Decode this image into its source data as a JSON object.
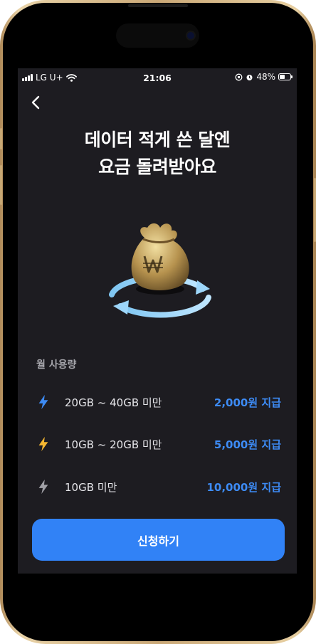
{
  "status_bar": {
    "carrier": "LG U+",
    "time": "21:06",
    "battery": "48%",
    "battery_level": 0.48
  },
  "header": {
    "back_icon": "chevron-left-icon"
  },
  "hero": {
    "title_line1": "데이터 적게 쓴 달엔",
    "title_line2": "요금 돌려받아요",
    "illustration_icon": "money-bag-icon"
  },
  "usage": {
    "section_label": "월 사용량",
    "tiers": [
      {
        "range": "20GB ~ 40GB 미만",
        "amount": "2,000원 지급",
        "icon": "lightning-icon",
        "icon_color": "#3d8bf5"
      },
      {
        "range": "10GB ~ 20GB 미만",
        "amount": "5,000원 지급",
        "icon": "lightning-icon",
        "icon_color": "#f5b731"
      },
      {
        "range": "10GB 미만",
        "amount": "10,000원 지급",
        "icon": "lightning-icon",
        "icon_color": "#a0a0a6"
      }
    ]
  },
  "cta": {
    "apply_label": "신청하기"
  },
  "colors": {
    "background": "#1d1c21",
    "accent": "#3182f6",
    "amount_text": "#3d8bf5"
  }
}
